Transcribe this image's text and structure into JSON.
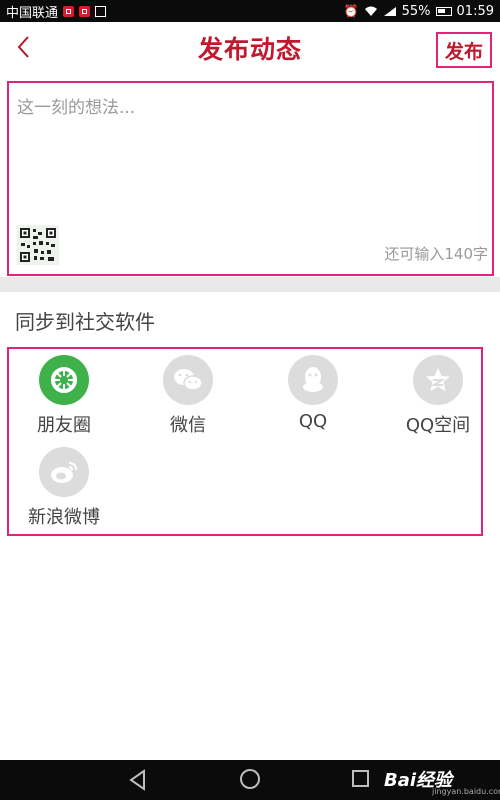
{
  "status_bar": {
    "carrier": "中国联通",
    "battery": "55%",
    "time": "01:59"
  },
  "header": {
    "title": "发布动态",
    "publish_label": "发布"
  },
  "compose": {
    "placeholder": "这一刻的想法...",
    "remaining": "还可输入140字"
  },
  "share": {
    "section_title": "同步到社交软件",
    "items": [
      {
        "label": "朋友圈",
        "icon": "moments-icon",
        "active": true
      },
      {
        "label": "微信",
        "icon": "wechat-icon",
        "active": false
      },
      {
        "label": "QQ",
        "icon": "qq-icon",
        "active": false
      },
      {
        "label": "QQ空间",
        "icon": "qzone-icon",
        "active": false
      },
      {
        "label": "新浪微博",
        "icon": "weibo-icon",
        "active": false
      }
    ]
  },
  "watermark": {
    "brand": "Bai经验",
    "url": "jingyan.baidu.com"
  },
  "colors": {
    "accent": "#c0182e",
    "highlight_box": "#e0247a",
    "active_icon": "#3fb14a",
    "inactive_icon": "#dcdcdc"
  }
}
